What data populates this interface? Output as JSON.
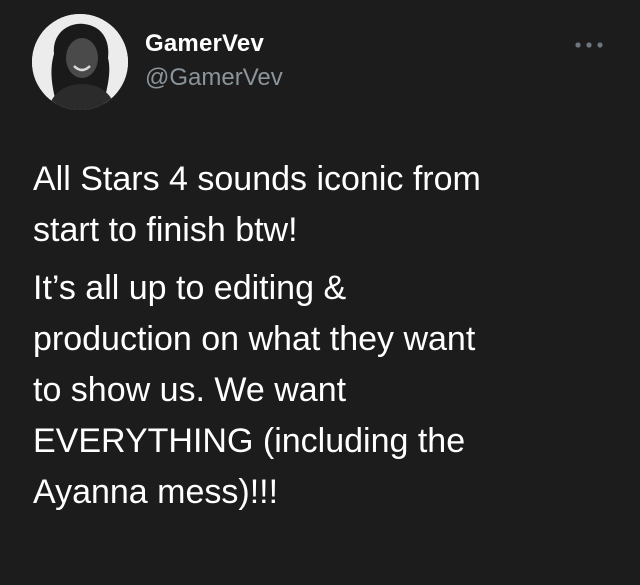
{
  "user": {
    "display_name": "GamerVev",
    "handle": "@GamerVev"
  },
  "tweet": {
    "paragraphs": [
      "All Stars 4 sounds iconic from\nstart to finish btw!",
      "It’s all up to editing &\nproduction on what they want\nto show us. We want\nEVERYTHING (including the\nAyanna mess)!!!"
    ]
  },
  "icons": {
    "avatar": "profile-photo",
    "more": "more-horizontal-icon"
  },
  "colors": {
    "background": "#1c1c1c",
    "text": "#ffffff",
    "secondary_text": "#8b949a"
  }
}
